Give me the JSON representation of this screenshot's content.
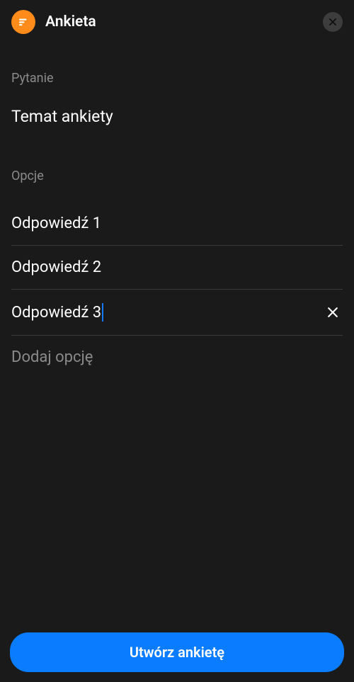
{
  "header": {
    "title": "Ankieta"
  },
  "question": {
    "label": "Pytanie",
    "value": "Temat ankiety"
  },
  "options": {
    "label": "Opcje",
    "items": [
      {
        "value": "Odpowiedź 1",
        "removable": false,
        "active": false
      },
      {
        "value": "Odpowiedź 2",
        "removable": false,
        "active": false
      },
      {
        "value": "Odpowiedź 3",
        "removable": true,
        "active": true
      }
    ],
    "add_label": "Dodaj opcję"
  },
  "footer": {
    "create_label": "Utwórz ankietę"
  },
  "colors": {
    "accent": "#0a7cff",
    "icon_bg": "#ff8c1a"
  }
}
